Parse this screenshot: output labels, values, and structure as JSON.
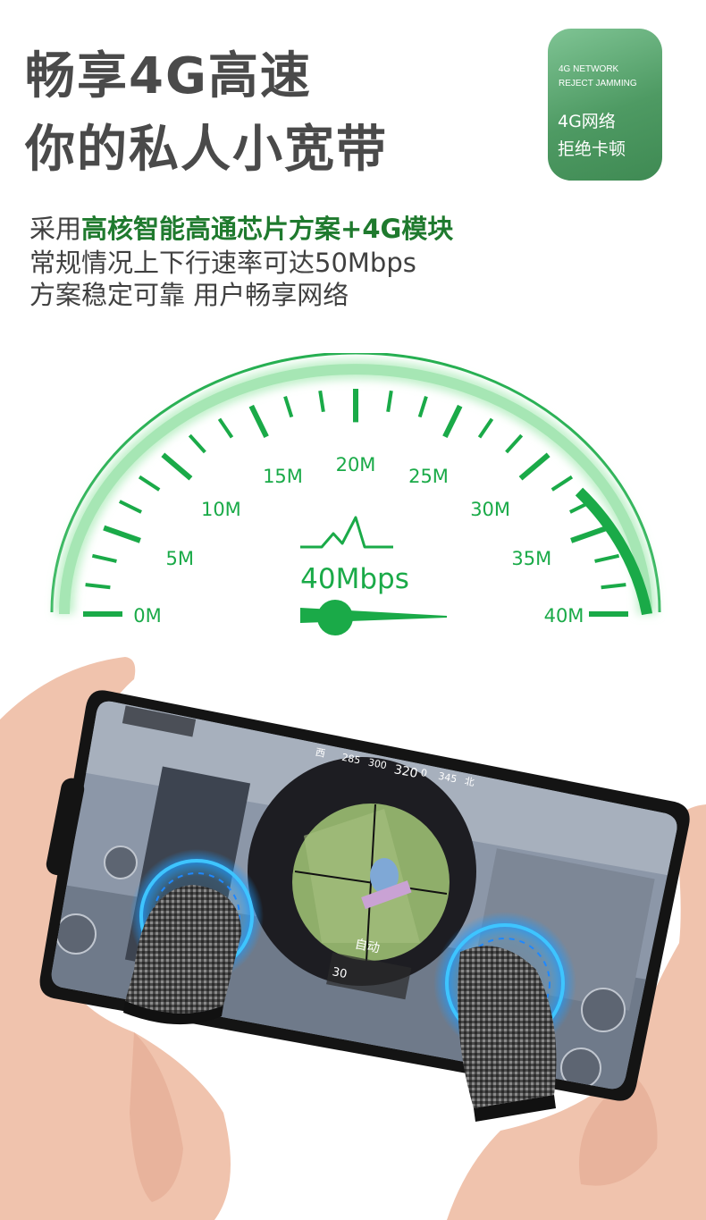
{
  "headline": {
    "line1": "畅享4G高速",
    "line2": "你的私人小宽带"
  },
  "badge": {
    "en_line1": "4G NETWORK",
    "en_line2": "REJECT JAMMING",
    "cn_line1": "4G网络",
    "cn_line2": "拒绝卡顿"
  },
  "description": {
    "line1_prefix": "采用",
    "line1_highlight": "高核智能高通芯片方案+4G模块",
    "line2": "常规情况上下行速率可达50Mbps",
    "line3": "方案稳定可靠 用户畅享网络"
  },
  "gauge": {
    "labels": [
      "0M",
      "5M",
      "10M",
      "15M",
      "20M",
      "25M",
      "30M",
      "35M",
      "40M"
    ],
    "readout": "40Mbps",
    "needle_value": 40,
    "max_value": 40,
    "colors": {
      "green": "#1aaa48",
      "light_green": "#a6e6b4",
      "dark_green": "#128a35"
    }
  },
  "game_hud": {
    "heading_numbers": [
      "西",
      "285",
      "300",
      "320",
      "0",
      "345",
      "北"
    ],
    "fire_mode": "自动",
    "ammo": "30"
  }
}
